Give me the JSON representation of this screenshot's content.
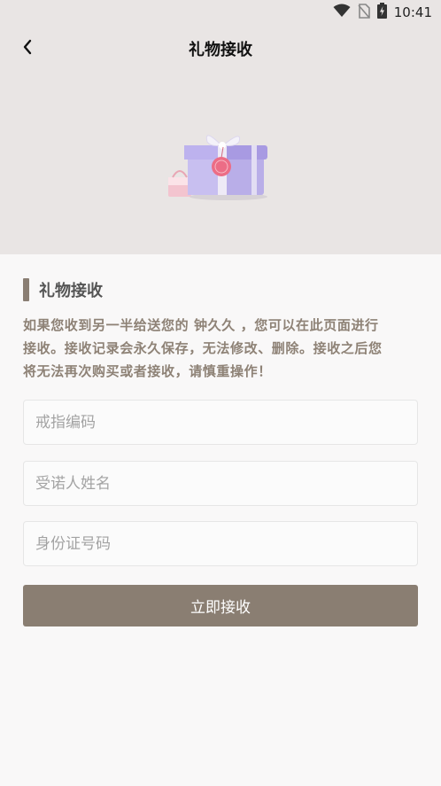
{
  "status_bar": {
    "time": "10:41",
    "icons": [
      "wifi-icon",
      "no-sim-icon",
      "battery-charging-icon"
    ]
  },
  "nav": {
    "title": "礼物接收",
    "back_icon": "chevron-left-icon"
  },
  "hero": {
    "illustration": "gift-box-illustration",
    "colors": {
      "background": "#e9e5e4",
      "box": "#b9aee8",
      "ribbon": "#eeeaf6",
      "tag": "#ec6d86"
    }
  },
  "section": {
    "title": "礼物接收",
    "notice_lines": [
      "如果您收到另一半给送您的 钟久久 ，您可以在此页面进行",
      "接收。接收记录会永久保存，无法修改、删除。接收之后您",
      "将无法再次购买或者接收，请慎重操作！"
    ]
  },
  "form": {
    "ring_code": {
      "placeholder": "戒指编码",
      "value": ""
    },
    "recipient_name": {
      "placeholder": "受诺人姓名",
      "value": ""
    },
    "id_number": {
      "placeholder": "身份证号码",
      "value": ""
    },
    "submit_label": "立即接收"
  },
  "colors": {
    "accent": "#8a7e72",
    "notice_text": "#8e8276"
  }
}
